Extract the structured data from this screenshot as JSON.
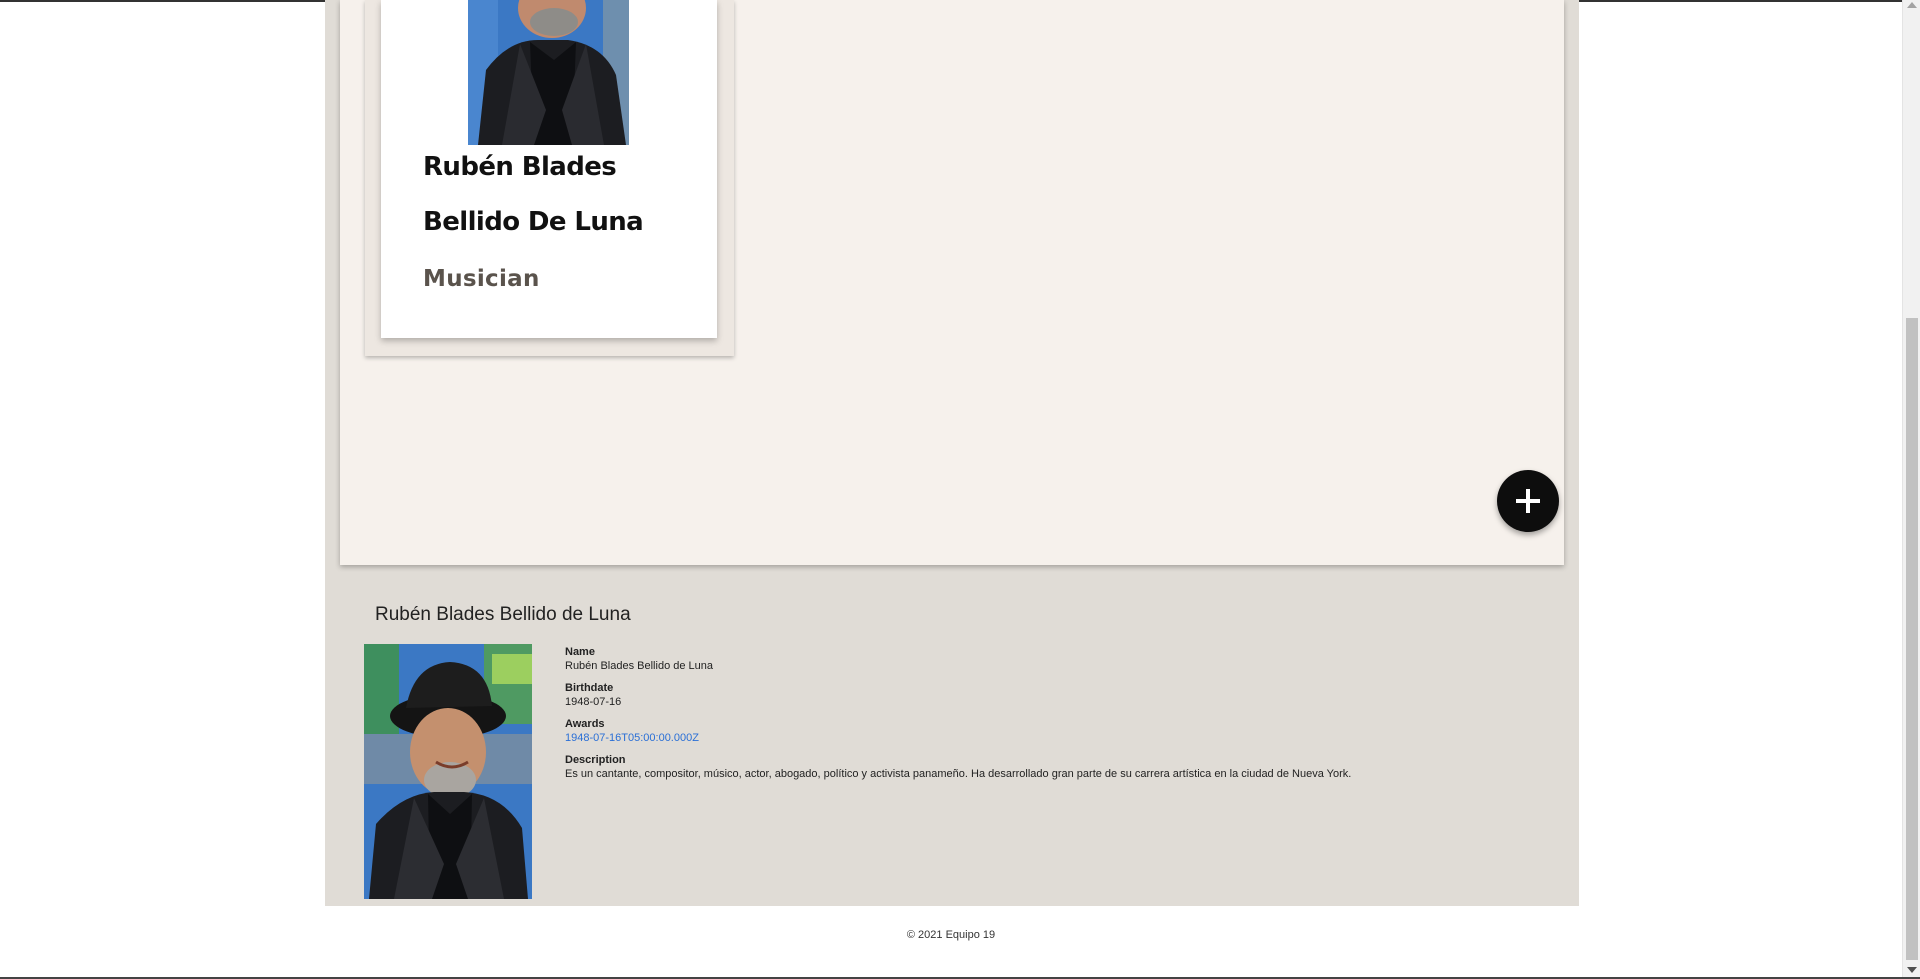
{
  "card": {
    "name": "Rubén Blades Bellido De Luna",
    "role": "Musician"
  },
  "fab": {
    "icon": "plus-icon"
  },
  "detail": {
    "title": "Rubén Blades Bellido de Luna",
    "fields": {
      "name_label": "Name",
      "name_value": "Rubén Blades Bellido de Luna",
      "birthdate_label": "Birthdate",
      "birthdate_value": "1948-07-16",
      "awards_label": "Awards",
      "awards_value": "1948-07-16T05:00:00.000Z",
      "description_label": "Description",
      "description_value": "Es un cantante, compositor, músico, actor, abogado, político y activista panameño. Ha desarrollado gran parte de su carrera artística en la ciudad de Nueva York."
    }
  },
  "footer": {
    "text": "© 2021 Equipo 19"
  },
  "colors": {
    "page_bg": "#ffffff",
    "wrap_bg": "#e0dcd6",
    "panel_bg": "#f6f1ec",
    "fab_bg": "#0d0d0d",
    "link": "#2a6fd6"
  }
}
